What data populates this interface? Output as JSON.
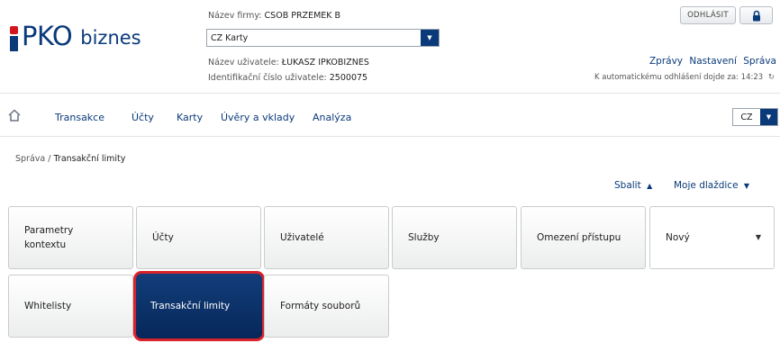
{
  "logo": {
    "brand": "PKO",
    "suffix": "biznes"
  },
  "header": {
    "firm_label": "Název firmy:",
    "firm_name": "CSOB PRZEMEK B",
    "context_select": "CZ Karty",
    "user_label": "Název uživatele:",
    "user_name": "ŁUKASZ IPKOBIZNES",
    "user_id_label": "Identifikační číslo uživatele:",
    "user_id": "2500075",
    "logout_button": "ODHLÁSIT",
    "links": [
      "Zprávy",
      "Nastavení",
      "Správa"
    ],
    "auto_logout_text": "K automatickému odhlášení dojde za: 14:23"
  },
  "nav": {
    "items": [
      "Transakce",
      "Účty",
      "Karty",
      "Úvěry a vklady",
      "Analýza"
    ],
    "language": "CZ"
  },
  "breadcrumb": {
    "parent": "Správa",
    "separator": "/",
    "current": "Transakční limity"
  },
  "tiles_bar": {
    "collapse": "Sbalit",
    "my_tiles": "Moje dlaždice"
  },
  "tiles": [
    {
      "label": "Parametry\nkontextu"
    },
    {
      "label": "Účty"
    },
    {
      "label": "Uživatelé"
    },
    {
      "label": "Služby"
    },
    {
      "label": "Omezení přístupu"
    },
    {
      "label": "Nový"
    },
    {
      "label": "Whitelisty"
    },
    {
      "label": "Transakční limity",
      "active": true
    },
    {
      "label": "Formáty souborů"
    }
  ],
  "colors": {
    "brand_navy": "#0a3a7a",
    "brand_red": "#d3161b",
    "active_tile": "#07275a",
    "highlight_border": "#d9232a"
  }
}
